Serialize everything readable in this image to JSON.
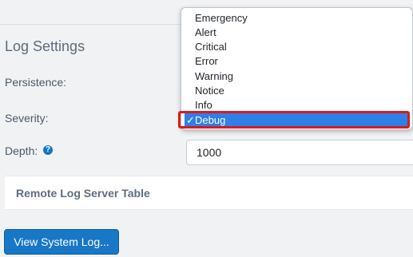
{
  "section": {
    "title": "Log Settings",
    "persistence_label": "Persistence:",
    "severity_label": "Severity:",
    "depth_label": "Depth:",
    "depth_value": "1000",
    "help_symbol": "?"
  },
  "remote_table": {
    "title": "Remote Log Server Table"
  },
  "buttons": {
    "view_system_log": "View System Log..."
  },
  "severity_dropdown": {
    "options": [
      "Emergency",
      "Alert",
      "Critical",
      "Error",
      "Warning",
      "Notice",
      "Info",
      "Debug"
    ],
    "selected": "Debug",
    "check_mark": "✓"
  },
  "colors": {
    "accent": "#1877c6",
    "selection": "#2f7fe9",
    "highlight_border": "#d81c1c"
  }
}
